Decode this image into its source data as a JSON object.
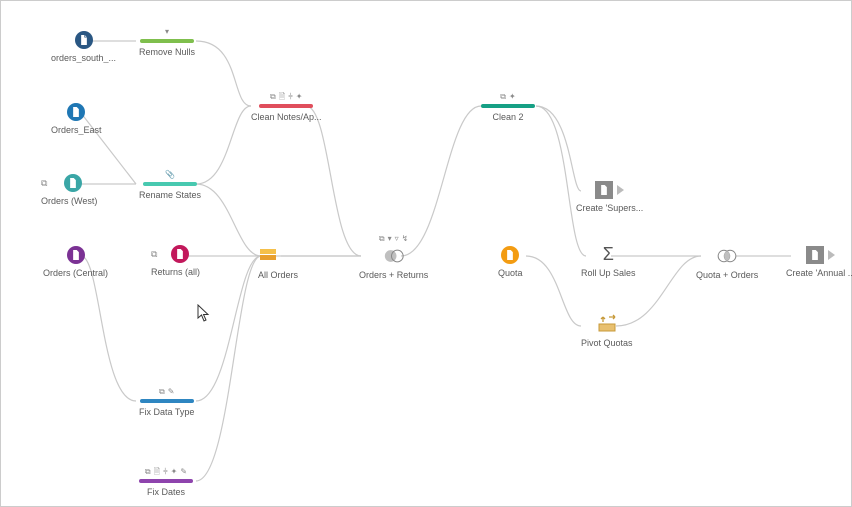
{
  "inputs": {
    "orders_south": {
      "label": "orders_south_..."
    },
    "orders_east": {
      "label": "Orders_East"
    },
    "orders_west": {
      "label": "Orders (West)"
    },
    "orders_central": {
      "label": "Orders (Central)"
    },
    "returns_all": {
      "label": "Returns (all)"
    },
    "quota": {
      "label": "Quota"
    }
  },
  "cleans": {
    "remove_nulls": {
      "label": "Remove Nulls",
      "icons": [
        "funnel"
      ]
    },
    "rename_states": {
      "label": "Rename States",
      "icons": [
        "clip"
      ]
    },
    "clean_notes": {
      "label": "Clean Notes/Ap...",
      "icons": [
        "copy",
        "doc",
        "group",
        "sparkle"
      ]
    },
    "fix_data_type": {
      "label": "Fix Data Type",
      "icons": [
        "copy",
        "wand"
      ]
    },
    "fix_dates": {
      "label": "Fix Dates",
      "icons": [
        "copy",
        "doc",
        "group",
        "sparkle",
        "wand"
      ]
    },
    "clean_2": {
      "label": "Clean 2",
      "icons": [
        "copy",
        "sparkle"
      ]
    }
  },
  "steps": {
    "all_orders": {
      "label": "All Orders"
    },
    "orders_returns": {
      "label": "Orders + Returns",
      "icons": [
        "copy",
        "funnel",
        "filter",
        "wand"
      ]
    },
    "roll_up_sales": {
      "label": "Roll Up Sales"
    },
    "pivot_quotas": {
      "label": "Pivot Quotas"
    },
    "quota_orders": {
      "label": "Quota + Orders"
    }
  },
  "outputs": {
    "superstore": {
      "label": "Create 'Supers..."
    },
    "annual": {
      "label": "Create 'Annual ..."
    }
  }
}
